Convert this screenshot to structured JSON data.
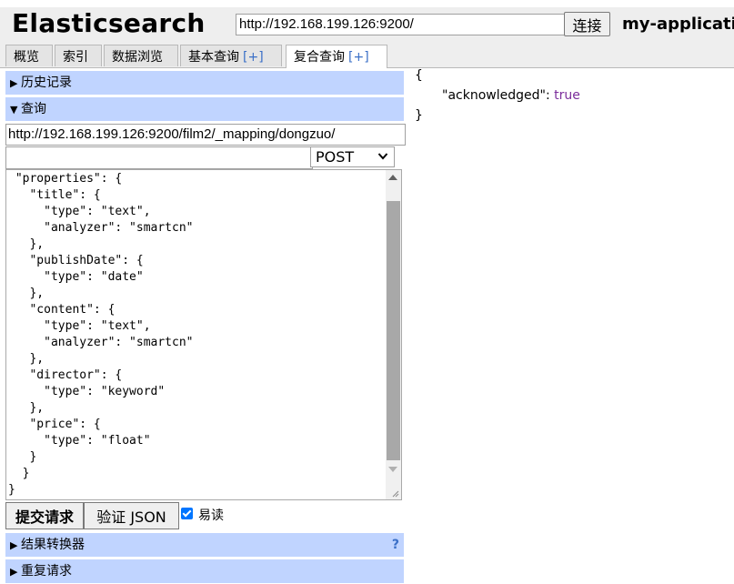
{
  "header": {
    "app_title": "Elasticsearch",
    "url": "http://192.168.199.126:9200/",
    "connect_label": "连接",
    "cluster_name": "my-application"
  },
  "tabs": [
    {
      "label": "概览",
      "plus": ""
    },
    {
      "label": "索引",
      "plus": ""
    },
    {
      "label": "数据浏览",
      "plus": ""
    },
    {
      "label": "基本查询",
      "plus": "[+]"
    },
    {
      "label": "复合查询",
      "plus": "[+]"
    }
  ],
  "active_tab": 4,
  "left_panel": {
    "history_label": "历史记录",
    "query_label": "查询",
    "query_path": "http://192.168.199.126:9200/film2/_mapping/dongzuo/",
    "query_extra": "",
    "method": "POST",
    "body": " \"properties\": {\n   \"title\": {\n     \"type\": \"text\",\n     \"analyzer\": \"smartcn\"\n   },\n   \"publishDate\": {\n     \"type\": \"date\"\n   },\n   \"content\": {\n     \"type\": \"text\",\n     \"analyzer\": \"smartcn\"\n   },\n   \"director\": {\n     \"type\": \"keyword\"\n   },\n   \"price\": {\n     \"type\": \"float\"\n   }\n  }\n}",
    "submit_label": "提交请求",
    "validate_label": "验证 JSON",
    "pretty_label": "易读",
    "pretty_checked": true,
    "transformer_label": "结果转换器",
    "transformer_help": "?",
    "repeat_label": "重复请求"
  },
  "output": {
    "open": "{",
    "key": "\"acknowledged\"",
    "sep": ": ",
    "value": "true",
    "close": "}"
  },
  "colors": {
    "section_header_bg": "#c0d4ff",
    "link_blue": "#3a6fc7",
    "bool_purple": "#7b2d9b",
    "checkbox_blue": "#0075ff"
  }
}
